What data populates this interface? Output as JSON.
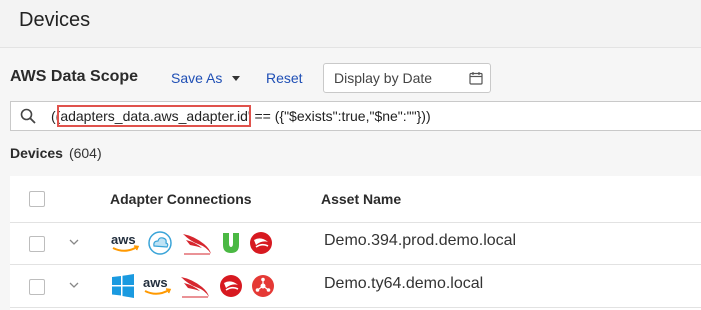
{
  "header": {
    "title": "Devices"
  },
  "scope": {
    "title": "AWS Data Scope",
    "save_as_label": "Save As",
    "reset_label": "Reset",
    "date_placeholder": "Display by Date"
  },
  "query": {
    "prefix": "((",
    "highlighted": "adapters_data.aws_adapter.id",
    "suffix": "' == ({\"$exists\":true,\"$ne\":\"\"}))"
  },
  "devices": {
    "label": "Devices",
    "count": "(604)"
  },
  "table": {
    "columns": [
      "Adapter Connections",
      "Asset Name"
    ],
    "rows": [
      {
        "adapters": [
          "aws",
          "cloud-sync",
          "crowdstrike",
          "jamf",
          "trend-micro"
        ],
        "asset_name": "Demo.394.prod.demo.local"
      },
      {
        "adapters": [
          "windows",
          "aws",
          "crowdstrike",
          "trend-micro",
          "network-hub"
        ],
        "asset_name": "Demo.ty64.demo.local"
      }
    ]
  },
  "colors": {
    "link": "#1f4fb5",
    "highlight": "#e0524c",
    "aws_orange": "#ff9900",
    "crowdstrike_red": "#d6262e",
    "jamf_green": "#4ab843",
    "trend_red": "#d71920",
    "windows_blue": "#1a9ae0"
  }
}
